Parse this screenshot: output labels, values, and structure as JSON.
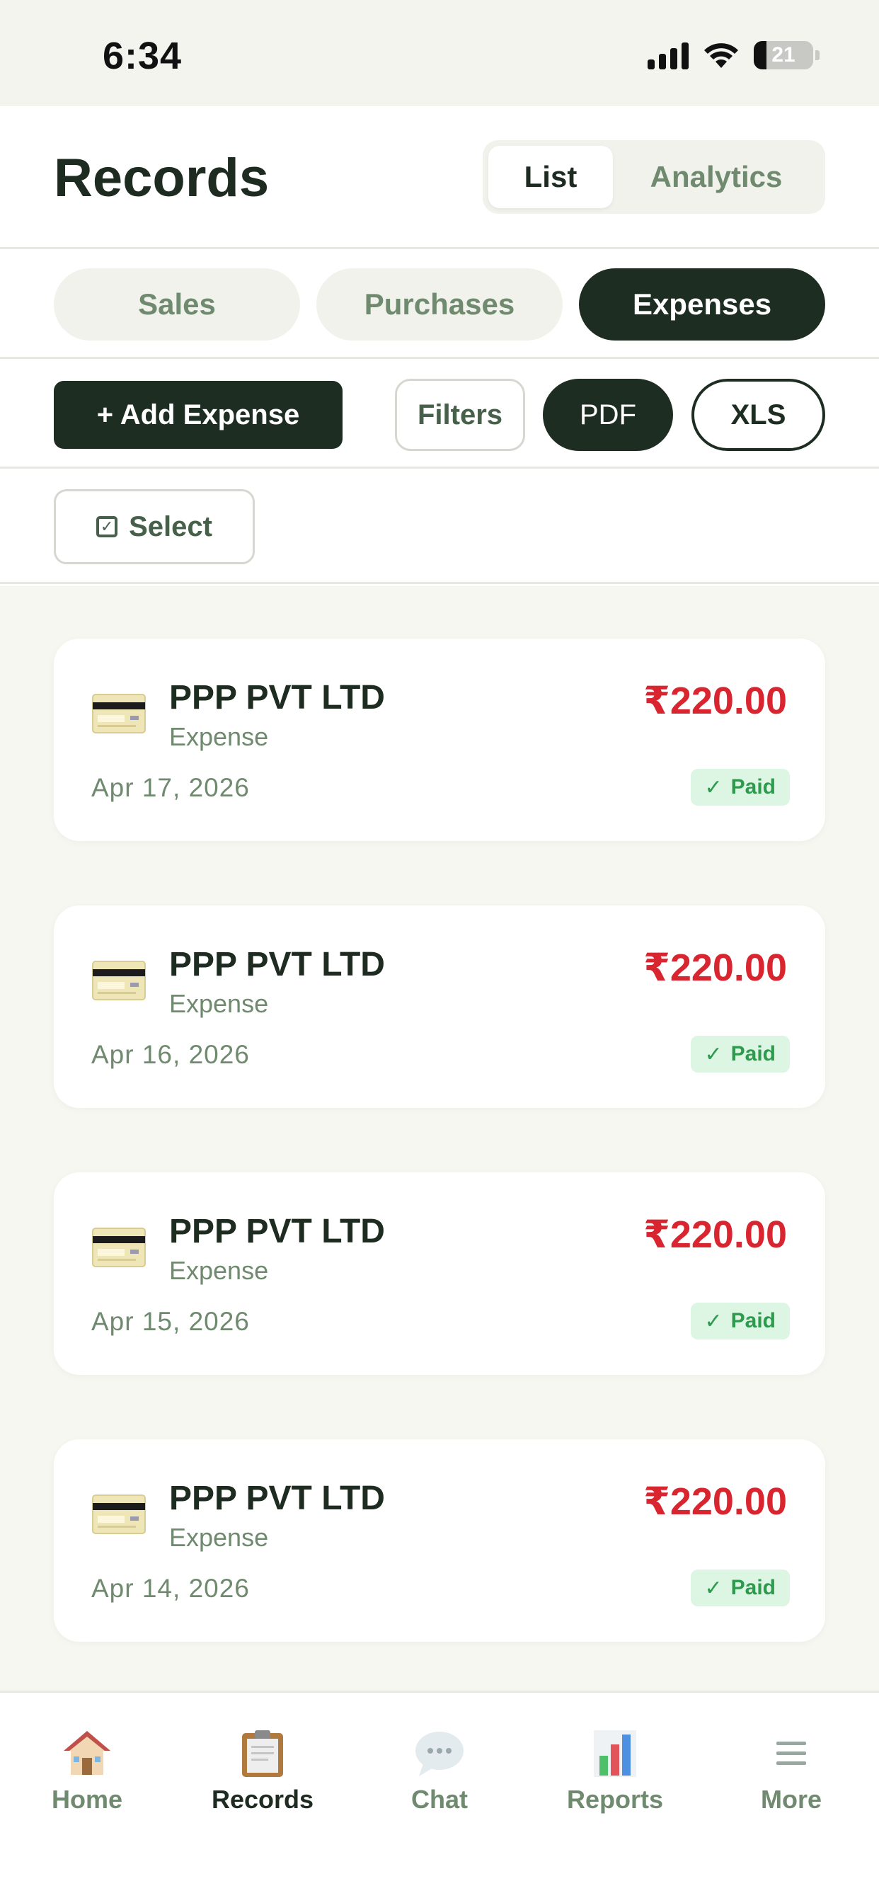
{
  "status_bar": {
    "time": "6:34",
    "battery": "21"
  },
  "header": {
    "title": "Records",
    "view_toggle": {
      "list": "List",
      "analytics": "Analytics",
      "selected": "List"
    }
  },
  "category_tabs": {
    "sales": "Sales",
    "purchases": "Purchases",
    "expenses": "Expenses",
    "selected": "Expenses"
  },
  "actions": {
    "add_expense": "+ Add Expense",
    "filters": "Filters",
    "pdf": "PDF",
    "xls": "XLS"
  },
  "select_button": {
    "label": "Select"
  },
  "records": [
    {
      "name": "PPP PVT LTD",
      "type": "Expense",
      "date": "Apr 17, 2026",
      "amount": "₹220.00",
      "status": "Paid"
    },
    {
      "name": "PPP PVT LTD",
      "type": "Expense",
      "date": "Apr 16, 2026",
      "amount": "₹220.00",
      "status": "Paid"
    },
    {
      "name": "PPP PVT LTD",
      "type": "Expense",
      "date": "Apr 15, 2026",
      "amount": "₹220.00",
      "status": "Paid"
    },
    {
      "name": "PPP PVT LTD",
      "type": "Expense",
      "date": "Apr 14, 2026",
      "amount": "₹220.00",
      "status": "Paid"
    }
  ],
  "bottom_nav": {
    "home": "Home",
    "records": "Records",
    "chat": "Chat",
    "reports": "Reports",
    "more": "More",
    "active": "Records"
  },
  "colors": {
    "primary_dark": "#1e2d22",
    "muted_green": "#6f8a6e",
    "amount_red": "#d8252f",
    "paid_green": "#2e9a4e",
    "paid_bg": "#dcf6e3",
    "list_bg": "#f7f7f1"
  },
  "icons": {
    "record_item": "credit-card-icon",
    "nav_home": "house-icon",
    "nav_records": "clipboard-icon",
    "nav_chat": "speech-bubble-icon",
    "nav_reports": "bar-chart-icon",
    "nav_more": "hamburger-menu-icon"
  }
}
